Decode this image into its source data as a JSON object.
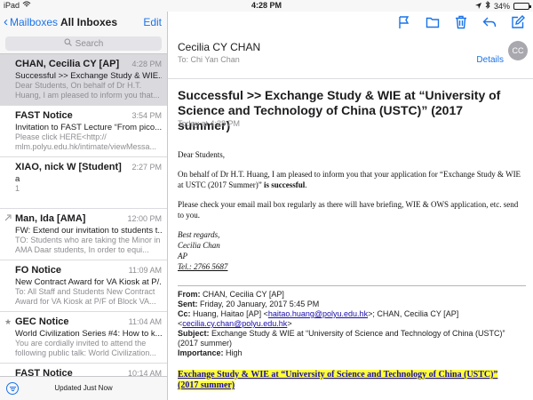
{
  "status_bar": {
    "device": "iPad",
    "time": "4:28 PM",
    "battery": "34%",
    "battery_level": 0.34
  },
  "left_nav": {
    "back_label": "Mailboxes",
    "title": "All Inboxes",
    "edit_label": "Edit",
    "search_placeholder": "Search"
  },
  "messages": [
    {
      "sender": "CHAN, Cecilia CY [AP]",
      "time": "4:28 PM",
      "subject": "Successful >> Exchange Study & WIE...",
      "preview": "Dear Students, On behalf of Dr H.T. Huang, I am pleased to inform you that..."
    },
    {
      "sender": "FAST Notice",
      "time": "3:54 PM",
      "subject": "Invitation to FAST Lecture “From pico...",
      "preview": "Please click HERE<http:// mlm.polyu.edu.hk/intimate/viewMessa..."
    },
    {
      "sender": "XIAO, nick W [Student]",
      "time": "2:27 PM",
      "subject": "a",
      "preview": "1"
    },
    {
      "sender": "Man, Ida [AMA]",
      "time": "12:00 PM",
      "subject": "FW: Extend our invitation to students t...",
      "preview": "TO: Students who are taking the Minor in AMA Daar students, In order to equi..."
    },
    {
      "sender": "FO Notice",
      "time": "11:09 AM",
      "subject": "New Contract Award for VA Kiosk at P/...",
      "preview": "To: All Staff and Students New Contract Award for VA Kiosk at P/F of Block VA..."
    },
    {
      "sender": "GEC Notice",
      "time": "11:04 AM",
      "subject": "World Civilization Series #4: How to k...",
      "preview": "You are cordially invited to attend the following public talk: World Civilization..."
    },
    {
      "sender": "FAST Notice",
      "time": "10:14 AM",
      "subject": "",
      "preview": ""
    }
  ],
  "bottom_bar": {
    "updated_text": "Updated Just Now"
  },
  "toolbar": {
    "icons": [
      "flag-icon",
      "folder-icon",
      "trash-icon",
      "reply-icon",
      "compose-icon"
    ]
  },
  "email": {
    "from_name": "Cecilia CY CHAN",
    "to_label": "To:",
    "to_name": "Chi Yan Chan",
    "details_label": "Details",
    "avatar_initials": "CC",
    "subject": "Successful >> Exchange Study & WIE at “University of Science and Technology of China (USTC)” (2017 summer)",
    "date": "Today at 4:28 PM",
    "greeting": "Dear Students,",
    "para1_a": "On behalf of Dr H.T. Huang, I am pleased to inform you that your application for “Exchange Study & WIE at USTC (2017 Summer)” ",
    "para1_b": "is successful",
    "para1_c": ".",
    "para2": "Please check your email mail box regularly as there will have briefing, WIE & OWS application, etc. send to you.",
    "sig_regards": "Best regards,",
    "sig_name": "Cecilia Chan",
    "sig_dept": "AP",
    "sig_tel": "Tel.: 2766 5687",
    "fwd_from_label": "From:",
    "fwd_from": "CHAN, Cecilia CY [AP]",
    "fwd_sent_label": "Sent:",
    "fwd_sent": "Friday, 20 January, 2017 5:45 PM",
    "fwd_cc_label": "Cc:",
    "fwd_cc_1": "Huang, Haitao [AP] <",
    "fwd_cc_1_mail": "haitao.huang@polyu.edu.hk",
    "fwd_cc_2": ">; CHAN, Cecilia CY [AP] <",
    "fwd_cc_2_mail": "cecilia.cy.chan@polyu.edu.hk",
    "fwd_cc_3": ">",
    "fwd_subject_label": "Subject:",
    "fwd_subject": "Exchange Study & WIE at “University of Science and Technology of China (USTC)” (2017 summer)",
    "fwd_importance_label": "Importance:",
    "fwd_importance": "High",
    "highlight_text": "Exchange Study & WIE at “University of Science and Technology of China (USTC)” (2017 summer)"
  },
  "colors": {
    "accent": "#1a73e8",
    "selected_row": "#d9d9de",
    "highlight": "#ffff3a"
  }
}
